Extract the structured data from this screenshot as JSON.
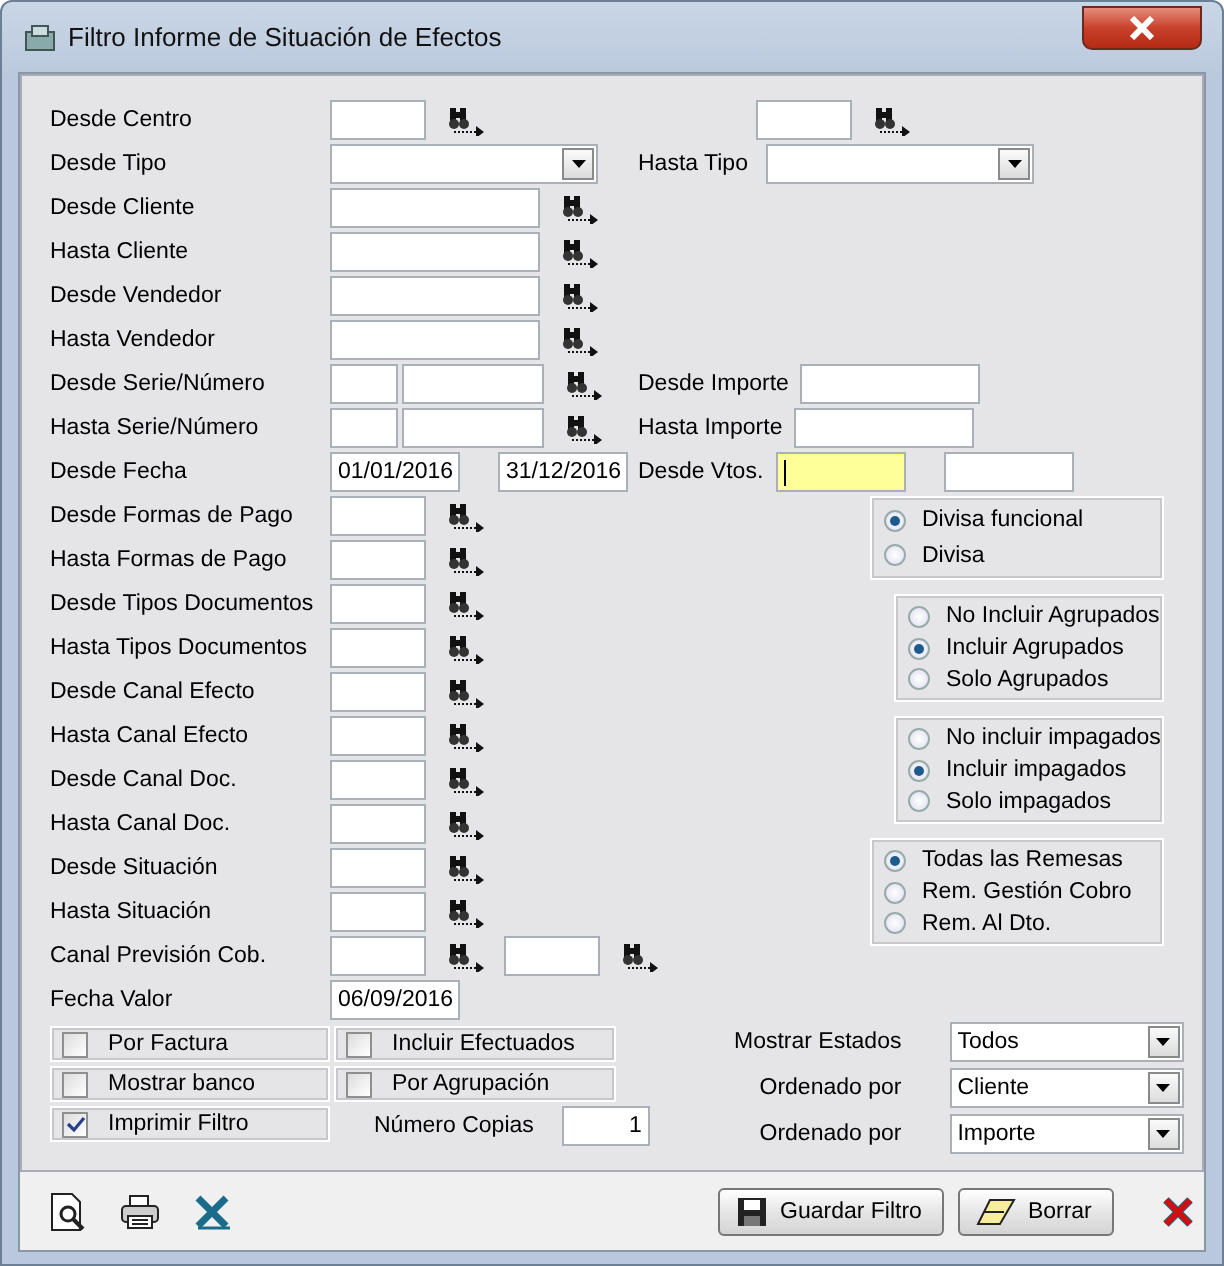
{
  "window": {
    "title": "Filtro Informe de Situación de Efectos"
  },
  "rows": [
    {
      "label": "Desde Centro",
      "fields": [
        {
          "kind": "code"
        },
        {
          "kind": "lookup"
        }
      ],
      "right": {
        "fields": [
          {
            "kind": "code"
          },
          {
            "kind": "lookup"
          }
        ]
      }
    },
    {
      "label": "Desde Tipo",
      "fields": [
        {
          "kind": "select"
        }
      ],
      "right": {
        "label": "Hasta Tipo",
        "fields": [
          {
            "kind": "select"
          }
        ]
      }
    },
    {
      "label": "Desde Cliente",
      "fields": [
        {
          "kind": "name"
        },
        {
          "kind": "lookup"
        }
      ]
    },
    {
      "label": "Hasta Cliente",
      "fields": [
        {
          "kind": "name"
        },
        {
          "kind": "lookup"
        }
      ]
    },
    {
      "label": "Desde Vendedor",
      "fields": [
        {
          "kind": "name"
        },
        {
          "kind": "lookup"
        }
      ]
    },
    {
      "label": "Hasta Vendedor",
      "fields": [
        {
          "kind": "name"
        },
        {
          "kind": "lookup"
        }
      ]
    },
    {
      "label": "Desde Serie/Número",
      "fields": [
        {
          "kind": "serie"
        },
        {
          "kind": "number"
        },
        {
          "kind": "lookup"
        }
      ],
      "right": {
        "label": "Desde Importe",
        "fields": [
          {
            "kind": "amount"
          }
        ]
      }
    },
    {
      "label": "Hasta Serie/Número",
      "fields": [
        {
          "kind": "serie"
        },
        {
          "kind": "number"
        },
        {
          "kind": "lookup"
        }
      ],
      "right": {
        "label": "Hasta Importe",
        "fields": [
          {
            "kind": "amount"
          }
        ]
      }
    },
    {
      "label": "Desde Fecha",
      "fields": [
        {
          "kind": "date",
          "value": "01/01/2016"
        },
        {
          "kind": "date",
          "value": "31/12/2016"
        }
      ],
      "right": {
        "label": "Desde Vtos.",
        "fields": [
          {
            "kind": "date",
            "focused": true
          },
          {
            "kind": "date",
            "focused": false
          }
        ]
      }
    },
    {
      "label": "Desde Formas de Pago",
      "fields": [
        {
          "kind": "code"
        },
        {
          "kind": "lookup"
        }
      ]
    },
    {
      "label": "Hasta Formas de Pago",
      "fields": [
        {
          "kind": "code"
        },
        {
          "kind": "lookup"
        }
      ]
    },
    {
      "label": "Desde Tipos Documentos",
      "fields": [
        {
          "kind": "code"
        },
        {
          "kind": "lookup"
        }
      ]
    },
    {
      "label": "Hasta Tipos Documentos",
      "fields": [
        {
          "kind": "code"
        },
        {
          "kind": "lookup"
        }
      ]
    },
    {
      "label": "Desde Canal Efecto",
      "fields": [
        {
          "kind": "code"
        },
        {
          "kind": "lookup"
        }
      ]
    },
    {
      "label": "Hasta Canal Efecto",
      "fields": [
        {
          "kind": "code"
        },
        {
          "kind": "lookup"
        }
      ]
    },
    {
      "label": "Desde Canal Doc.",
      "fields": [
        {
          "kind": "code"
        },
        {
          "kind": "lookup"
        }
      ]
    },
    {
      "label": "Hasta Canal Doc.",
      "fields": [
        {
          "kind": "code"
        },
        {
          "kind": "lookup"
        }
      ]
    },
    {
      "label": "Desde Situación",
      "fields": [
        {
          "kind": "code"
        },
        {
          "kind": "lookup"
        }
      ]
    },
    {
      "label": "Hasta Situación",
      "fields": [
        {
          "kind": "code"
        },
        {
          "kind": "lookup"
        }
      ]
    },
    {
      "label": "Canal Previsión Cob.",
      "fields": [
        {
          "kind": "code"
        },
        {
          "kind": "lookup"
        },
        {
          "kind": "code"
        },
        {
          "kind": "lookup"
        }
      ]
    },
    {
      "label": "Fecha Valor",
      "fields": [
        {
          "kind": "date",
          "value": "06/09/2016"
        }
      ]
    }
  ],
  "radio_groups": [
    {
      "options": [
        {
          "label": "Divisa funcional",
          "selected": true
        },
        {
          "label": "Divisa",
          "selected": false
        }
      ]
    },
    {
      "options": [
        {
          "label": "No Incluir Agrupados",
          "selected": false
        },
        {
          "label": "Incluir Agrupados",
          "selected": true
        },
        {
          "label": "Solo Agrupados",
          "selected": false
        }
      ]
    },
    {
      "options": [
        {
          "label": "No incluir impagados",
          "selected": false
        },
        {
          "label": "Incluir impagados",
          "selected": true
        },
        {
          "label": "Solo impagados",
          "selected": false
        }
      ]
    },
    {
      "options": [
        {
          "label": "Todas las Remesas",
          "selected": true
        },
        {
          "label": "Rem. Gestión Cobro",
          "selected": false
        },
        {
          "label": "Rem. Al Dto.",
          "selected": false
        }
      ]
    }
  ],
  "checks": [
    {
      "label": "Por Factura",
      "checked": false
    },
    {
      "label": "Incluir Efectuados",
      "checked": false
    },
    {
      "label": "Mostrar banco",
      "checked": false
    },
    {
      "label": "Por Agrupación",
      "checked": false
    },
    {
      "label": "Imprimir Filtro",
      "checked": true
    }
  ],
  "copies": {
    "label": "Número Copias",
    "value": "1"
  },
  "combos": [
    {
      "label": "Mostrar Estados",
      "value": "Todos"
    },
    {
      "label": "Ordenado por",
      "value": "Cliente"
    },
    {
      "label": "Ordenado por",
      "value": "Importe"
    }
  ],
  "toolbar": [
    {
      "kind": "preview"
    },
    {
      "kind": "print"
    },
    {
      "kind": "excel"
    }
  ],
  "buttons": [
    {
      "kind": "save",
      "label": "Guardar Filtro"
    },
    {
      "kind": "erase",
      "label": "Borrar"
    },
    {
      "kind": "cancel"
    }
  ]
}
